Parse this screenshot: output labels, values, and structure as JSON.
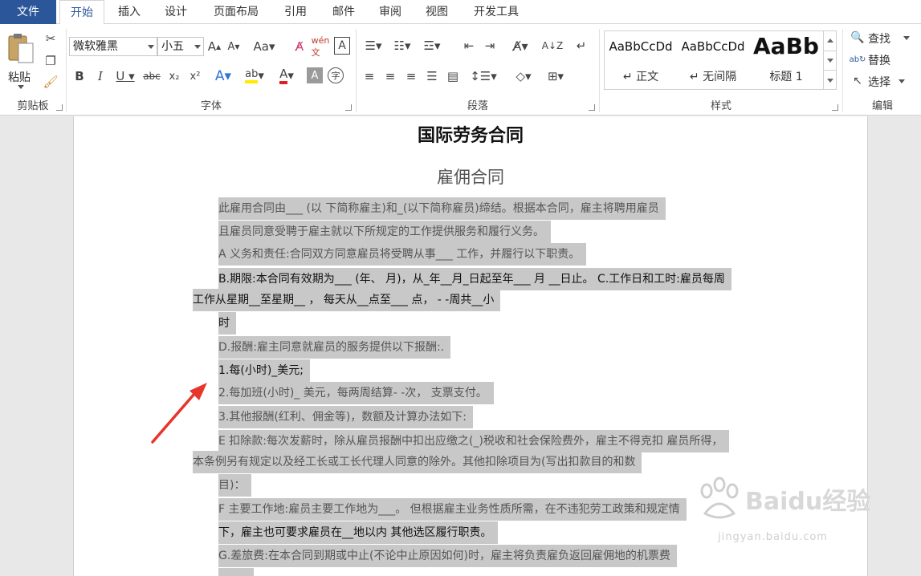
{
  "tabs": [
    "文件",
    "开始",
    "插入",
    "设计",
    "页面布局",
    "引用",
    "邮件",
    "审阅",
    "视图",
    "开发工具"
  ],
  "ribbon": {
    "clipboard": {
      "paste": "粘贴",
      "label": "剪贴板"
    },
    "font": {
      "name": "微软雅黑",
      "size": "小五",
      "label": "字体"
    },
    "paragraph": {
      "label": "段落"
    },
    "styles": {
      "label": "样式",
      "items": [
        {
          "sample": "AaBbCcDd",
          "name": "↵ 正文"
        },
        {
          "sample": "AaBbCcDd",
          "name": "↵ 无间隔"
        },
        {
          "sample": "AaBb",
          "name": "标题 1"
        }
      ]
    },
    "editing": {
      "find": "查找",
      "replace": "替换",
      "select": "选择",
      "label": "编辑"
    }
  },
  "document": {
    "title": "国际劳务合同",
    "subtitle": "雇佣合同",
    "lines": [
      "此雇用合同由___ (以  下简称雇主)和_(以下简称雇员)缔结。根据本合同，雇主将聘用雇员",
      "且雇员同意受聘于雇主就以下所规定的工作提供服务和履行义务。",
      "A 义务和责任:合同双方同意雇员将受聘从事___  工作，并履行以下职责。",
      "B.期限:本合同有效期为___ (年、  月)，从_年__月_日起至年___  月 __日止。   C.工作日和工时:雇员每周",
      "工作从星期__至星期__ ，   每天从__点至___  点，   - -周共__小",
      "时",
      "D.报酬:雇主同意就雇员的服务提供以下报酬:.",
      "1.每(小时)_美元;",
      "2.每加班(小时)_  美元，每两周结算- -次，   支票支付。",
      "3.其他报酬(红利、佣金等)，数额及计算办法如下:",
      "E 扣除款:每次发薪时，除从雇员报酬中扣出应缴之(_)税收和社会保险费外，雇主不得克扣  雇员所得，",
      "本条例另有规定以及经工长或工长代理人同意的除外。其他扣除项目为(写出扣款目的和数",
      "目)：",
      "F 主要工作地:雇员主要工作地为___。   但根据雇主业务性质所需，在不违犯劳工政策和规定情",
      "下，雇主也可要求雇员在__地以内  其他选区履行职责。",
      "G.差旅费:在本合同到期或中止(不论中止原因如何)时，雇主将负责雇负返回雇佣地的机票费"
    ]
  },
  "watermark": {
    "brand": "Baidu经验",
    "url": "jingyan.baidu.com"
  }
}
